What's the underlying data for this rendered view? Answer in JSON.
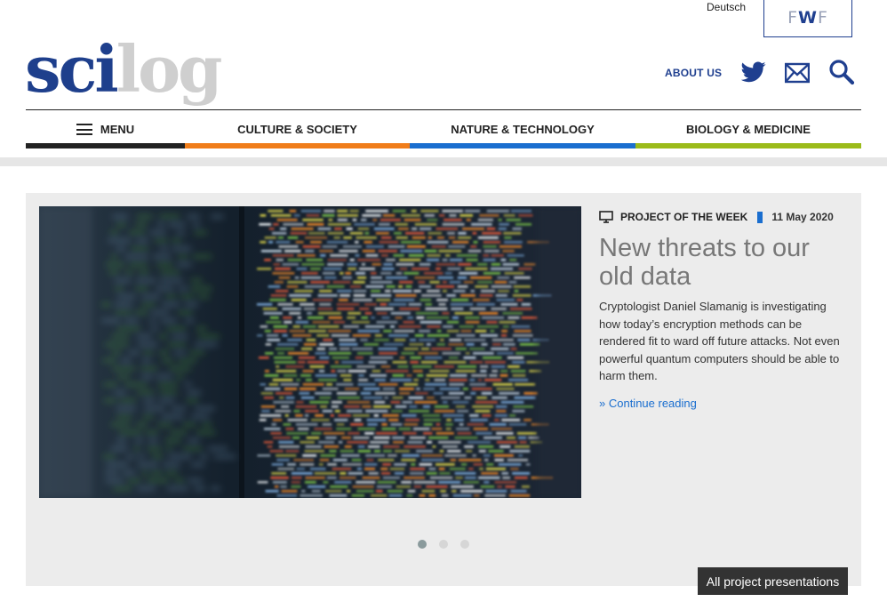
{
  "header": {
    "language_link": "Deutsch",
    "partner_logo": {
      "letters": [
        "F",
        "W",
        "F"
      ]
    },
    "logo": {
      "part1": "sci",
      "part2": "log"
    },
    "about_label": "ABOUT US",
    "icons": [
      "twitter-icon",
      "mail-icon",
      "search-icon"
    ]
  },
  "nav": {
    "items": [
      {
        "label": "MENU",
        "color": "#222222"
      },
      {
        "label": "CULTURE & SOCIETY",
        "color": "#f07d1a"
      },
      {
        "label": "NATURE & TECHNOLOGY",
        "color": "#1a6ecf"
      },
      {
        "label": "BIOLOGY & MEDICINE",
        "color": "#9bbb1a"
      }
    ]
  },
  "feature": {
    "category": "PROJECT OF THE WEEK",
    "date": "11 May 2020",
    "title": "New threats to our old data",
    "teaser": "Cryptologist Daniel Slamanig is investigating how today’s encryption methods can be rendered fit to ward off future attacks. Not even powerful quantum computers should be able to harm them.",
    "continue_label": "» Continue reading",
    "slides": 3,
    "active_slide": 1
  },
  "all_projects_label": "All project presentations",
  "colors": {
    "brand_blue": "#1e3f8c",
    "link_blue": "#1a6ecf",
    "orange": "#f07d1a",
    "green": "#9bbb1a"
  }
}
